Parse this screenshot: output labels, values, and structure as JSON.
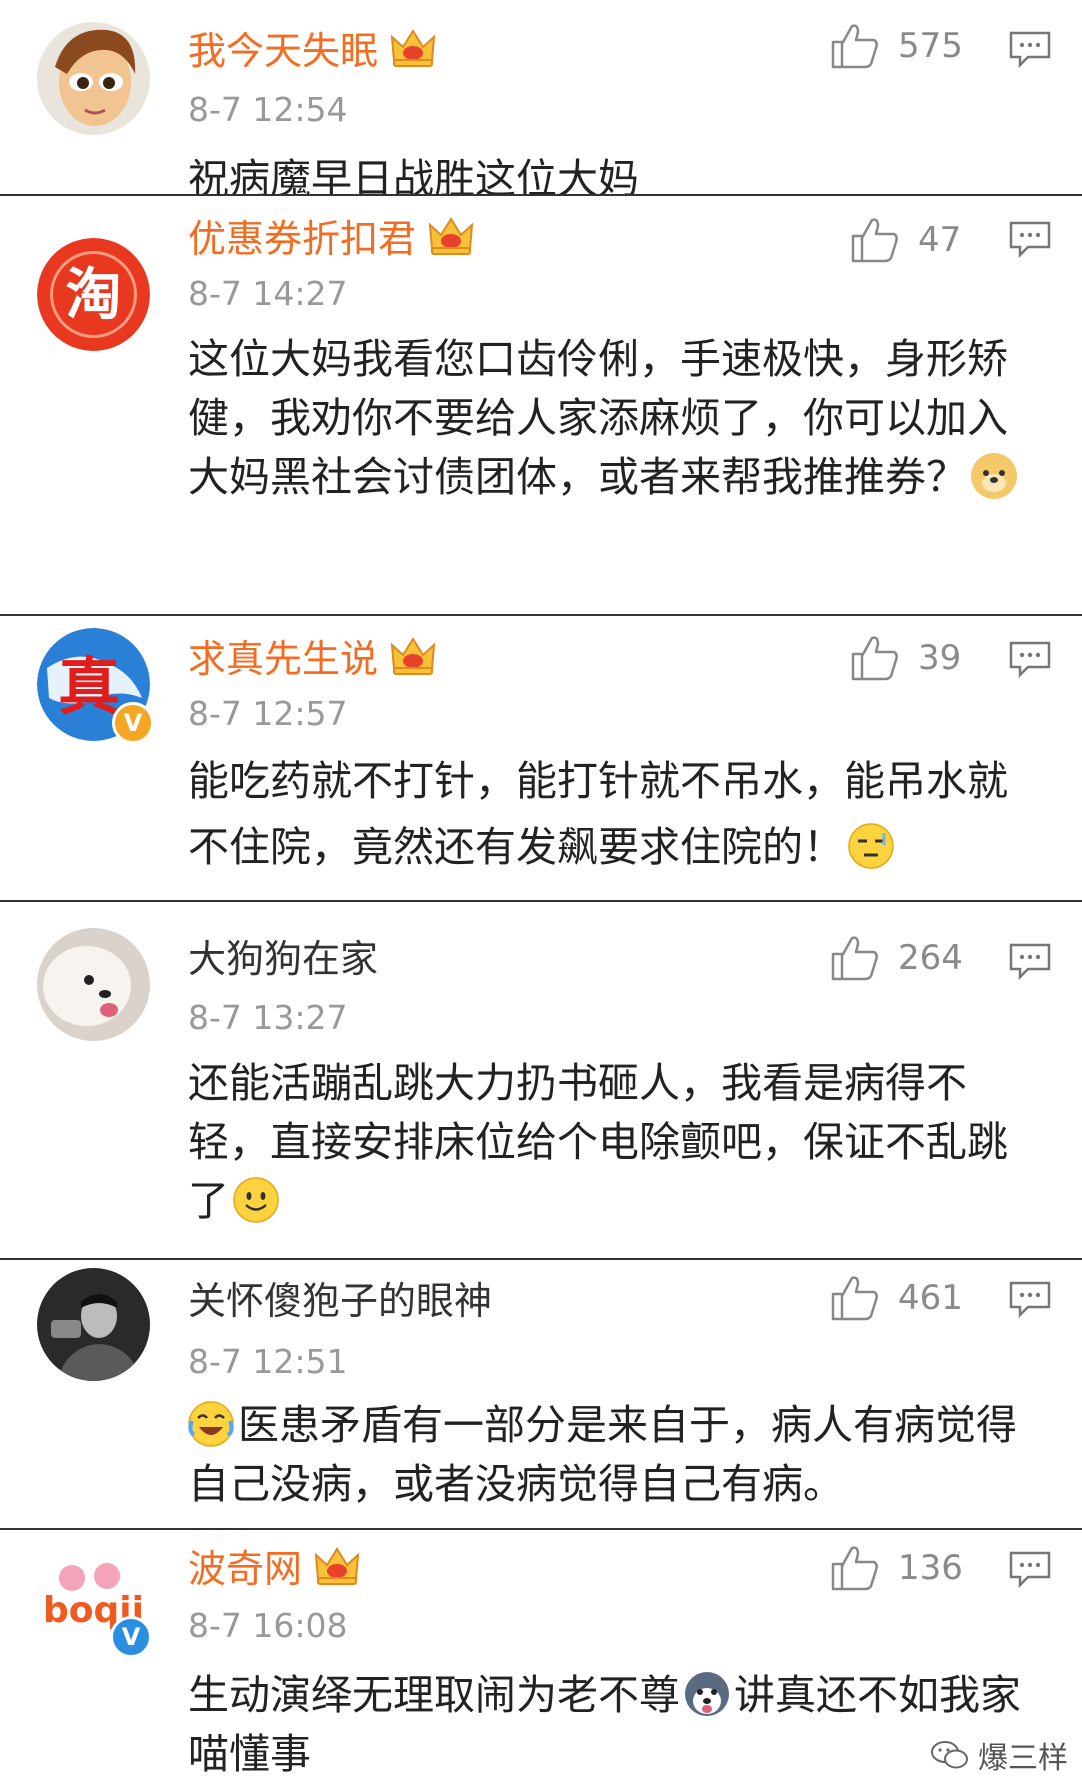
{
  "colors": {
    "vip_name": "#f36c21",
    "normal_name": "#333333",
    "time": "#999999",
    "divider": "#333333"
  },
  "comments": [
    {
      "username": "我今天失眠",
      "vip": true,
      "crown_level": "4",
      "time": "8-7 12:54",
      "likes": "575",
      "text": "祝病魔早日战胜这位大妈"
    },
    {
      "username": "优惠券折扣君",
      "vip": true,
      "crown_level": "2",
      "time": "8-7 14:27",
      "likes": "47",
      "text": "这位大妈我看您口齿伶俐，手速极快，身形矫健，我劝你不要给人家添麻烦了，你可以加入大妈黑社会讨债团体，或者来帮我推推券？",
      "emoji": "doge-emoji",
      "avatar_text": "淘"
    },
    {
      "username": "求真先生说",
      "vip": true,
      "crown_level": "4",
      "time": "8-7 12:57",
      "likes": "39",
      "text": "能吃药就不打针，能打针就不吊水，能吊水就不住院，竟然还有发飙要求住院的！",
      "emoji": "speechless-emoji",
      "avatar_text": "真"
    },
    {
      "username": "大狗狗在家",
      "vip": false,
      "time": "8-7 13:27",
      "likes": "264",
      "text": "还能活蹦乱跳大力扔书砸人，我看是病得不轻，直接安排床位给个电除颤吧，保证不乱跳了",
      "emoji": "smile-emoji"
    },
    {
      "username": "关怀傻狍子的眼神",
      "vip": false,
      "time": "8-7 12:51",
      "likes": "461",
      "text": "医患矛盾有一部分是来自于，病人有病觉得自己没病，或者没病觉得自己有病。",
      "emoji": "laugh-cry-emoji"
    },
    {
      "username": "波奇网",
      "vip": true,
      "crown_level": "5",
      "time": "8-7 16:08",
      "likes": "136",
      "text_before": "生动演绎无理取闹为老不尊",
      "text_after": "讲真还不如我家喵懂事",
      "emoji": "husky-emoji",
      "avatar_text": "boqii"
    }
  ],
  "watermark": "爆三样"
}
